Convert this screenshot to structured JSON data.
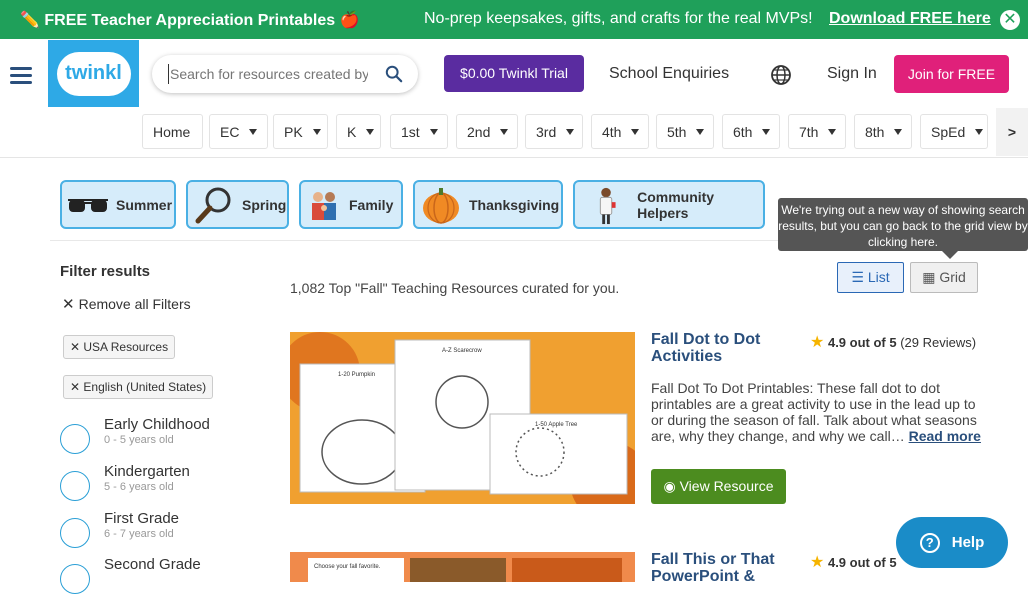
{
  "promo": {
    "left_text": "✏️ FREE Teacher Appreciation Printables 🍎",
    "middle_text": "No-prep keepsakes, gifts, and crafts for the real MVPs!",
    "link_text": "Download FREE here",
    "close_symbol": "✕",
    "bg_color": "#1fa05a"
  },
  "header": {
    "logo_text": "twinkl",
    "search_placeholder": "Search for resources created by teachers",
    "trial_label": "$0.00 Twinkl Trial",
    "school_enquiries_label": "School Enquiries",
    "sign_in_label": "Sign In",
    "join_label": "Join for FREE"
  },
  "grades": {
    "items": [
      "Home",
      "EC",
      "PK",
      "K",
      "1st",
      "2nd",
      "3rd",
      "4th",
      "5th",
      "6th",
      "7th",
      "8th",
      "SpEd"
    ],
    "more_label": ">"
  },
  "topics": [
    "Summer",
    "Spring",
    "Family",
    "Thanksgiving",
    "Community Helpers"
  ],
  "tooltip": "We're trying out a new way of showing search results, but you can go back to the grid view by clicking here.",
  "view_toggle": {
    "list_label": "List",
    "grid_label": "Grid"
  },
  "filters": {
    "title": "Filter results",
    "remove_all_label": "Remove all Filters",
    "chips": [
      "USA Resources",
      "English (United States)"
    ],
    "ages": [
      {
        "name": "Early Childhood",
        "range": "0 - 5 years old"
      },
      {
        "name": "Kindergarten",
        "range": "5 - 6 years old"
      },
      {
        "name": "First Grade",
        "range": "6 - 7 years old"
      },
      {
        "name": "Second Grade",
        "range": ""
      }
    ]
  },
  "results": {
    "count_text": "1,082 Top \"Fall\" Teaching Resources curated for you.",
    "items": [
      {
        "title": "Fall Dot to Dot Activities",
        "rating_score": "4.9 out of 5",
        "rating_count": "(29 Reviews)",
        "description": "Fall Dot To Dot Printables: These fall dot to dot printables are a great activity to use in the lead up to or during the season of fall. Talk about what seasons are, why they change, and why we call…",
        "read_more_label": "Read more",
        "view_label": "View Resource",
        "thumb_labels": [
          "1-20 Pumpkin",
          "A-Z Scarecrow",
          "1-50 Apple Tree"
        ]
      },
      {
        "title": "Fall This or That PowerPoint &",
        "rating_score": "4.9 out of 5",
        "thumb_labels": [
          "Choose your fall favorite."
        ]
      }
    ]
  },
  "help_label": "Help"
}
